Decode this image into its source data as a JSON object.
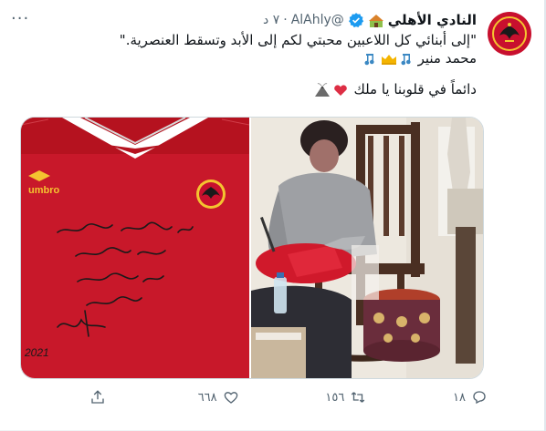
{
  "tweet": {
    "author_name": "النادي الأهلي",
    "handle": "@AlAhly",
    "separator": "·",
    "time": "٧ د",
    "more": "···",
    "quote_line": "\"إلى أبنائي كل اللاعبين محبتي لكم إلى الأبد وتسقط العنصرية.\"",
    "signature_name": "محمد منير",
    "closing_line": "دائماً في قلوبنا يا ملك"
  },
  "media": {
    "left_photo_alt": "Red Al Ahly shirt signed in Arabic",
    "left_photo_year": "2021",
    "right_photo_alt": "Mohamed Mounir signing the shirt"
  },
  "actions": {
    "reply_count": "١٨",
    "retweet_count": "١٥٦",
    "like_count": "٦٦٨",
    "share_label": ""
  },
  "colors": {
    "brand_red": "#c8102e",
    "verified_blue": "#1d9bf0",
    "muted": "#536471",
    "border": "#cfd9de"
  },
  "icons": [
    "avatar-logo",
    "house-emoji",
    "verified-badge-icon",
    "more-icon",
    "music-notes-icon",
    "crown-icon",
    "volcano-icon",
    "heart-emoji-icon",
    "reply-icon",
    "retweet-icon",
    "like-icon",
    "share-icon"
  ]
}
